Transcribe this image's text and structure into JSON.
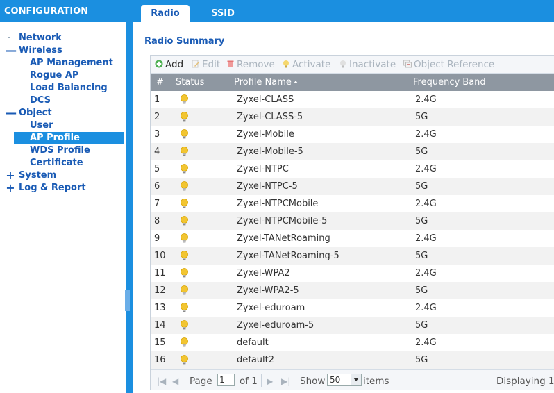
{
  "sidebar": {
    "header": "CONFIGURATION",
    "items": [
      {
        "label": "Network",
        "level": 0,
        "toggle": "",
        "selected": false
      },
      {
        "label": "Wireless",
        "level": 0,
        "toggle": "—",
        "selected": false
      },
      {
        "label": "AP Management",
        "level": 1,
        "toggle": "",
        "selected": false
      },
      {
        "label": "Rogue AP",
        "level": 1,
        "toggle": "",
        "selected": false
      },
      {
        "label": "Load Balancing",
        "level": 1,
        "toggle": "",
        "selected": false
      },
      {
        "label": "DCS",
        "level": 1,
        "toggle": "",
        "selected": false
      },
      {
        "label": "Object",
        "level": 0,
        "toggle": "—",
        "selected": false
      },
      {
        "label": "User",
        "level": 1,
        "toggle": "",
        "selected": false
      },
      {
        "label": "AP Profile",
        "level": 1,
        "toggle": "",
        "selected": true
      },
      {
        "label": "WDS Profile",
        "level": 1,
        "toggle": "",
        "selected": false
      },
      {
        "label": "Certificate",
        "level": 1,
        "toggle": "",
        "selected": false
      },
      {
        "label": "System",
        "level": 0,
        "toggle": "+",
        "selected": false
      },
      {
        "label": "Log & Report",
        "level": 0,
        "toggle": "+",
        "selected": false
      }
    ]
  },
  "tabs": {
    "radio": "Radio",
    "ssid": "SSID"
  },
  "section_title": "Radio Summary",
  "toolbar": {
    "add": "Add",
    "edit": "Edit",
    "remove": "Remove",
    "activate": "Activate",
    "inactivate": "Inactivate",
    "object_reference": "Object Reference"
  },
  "table": {
    "headers": {
      "num": "#",
      "status": "Status",
      "profile_name": "Profile Name",
      "frequency_band": "Frequency Band"
    },
    "rows": [
      {
        "num": "1",
        "name": "Zyxel-CLASS",
        "band": "2.4G"
      },
      {
        "num": "2",
        "name": "Zyxel-CLASS-5",
        "band": "5G"
      },
      {
        "num": "3",
        "name": "Zyxel-Mobile",
        "band": "2.4G"
      },
      {
        "num": "4",
        "name": "Zyxel-Mobile-5",
        "band": "5G"
      },
      {
        "num": "5",
        "name": "Zyxel-NTPC",
        "band": "2.4G"
      },
      {
        "num": "6",
        "name": "Zyxel-NTPC-5",
        "band": "5G"
      },
      {
        "num": "7",
        "name": "Zyxel-NTPCMobile",
        "band": "2.4G"
      },
      {
        "num": "8",
        "name": "Zyxel-NTPCMobile-5",
        "band": "5G"
      },
      {
        "num": "9",
        "name": "Zyxel-TANetRoaming",
        "band": "2.4G"
      },
      {
        "num": "10",
        "name": "Zyxel-TANetRoaming-5",
        "band": "5G"
      },
      {
        "num": "11",
        "name": "Zyxel-WPA2",
        "band": "2.4G"
      },
      {
        "num": "12",
        "name": "Zyxel-WPA2-5",
        "band": "5G"
      },
      {
        "num": "13",
        "name": "Zyxel-eduroam",
        "band": "2.4G"
      },
      {
        "num": "14",
        "name": "Zyxel-eduroam-5",
        "band": "5G"
      },
      {
        "num": "15",
        "name": "default",
        "band": "2.4G"
      },
      {
        "num": "16",
        "name": "default2",
        "band": "5G"
      }
    ]
  },
  "pager": {
    "page_label": "Page",
    "page_value": "1",
    "of_label": "of 1",
    "show_label": "Show",
    "show_value": "50",
    "items_label": "items",
    "displaying": "Displaying 1"
  },
  "colors": {
    "accent": "#1b8fe0",
    "nav_text": "#1a5bb5",
    "header_gray": "#8e97a1",
    "bulb": "#f2c531"
  },
  "icons": {
    "add": "add-circle-icon",
    "edit": "edit-pencil-icon",
    "remove": "trash-icon",
    "activate": "bulb-on-icon",
    "inactivate": "bulb-off-icon",
    "object_reference": "object-reference-icon",
    "status": "bulb-on-icon"
  }
}
